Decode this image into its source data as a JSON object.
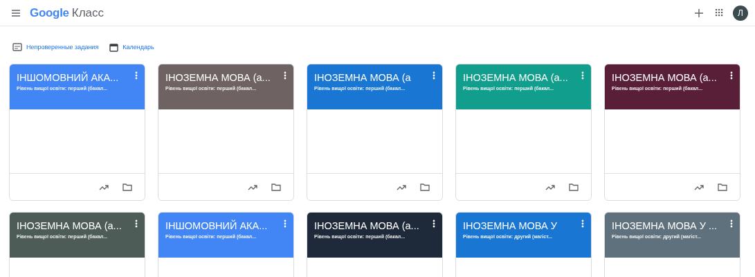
{
  "app_bar": {
    "logo_google": "Google",
    "logo_product": "Класс",
    "avatar_letter": "Л"
  },
  "links": [
    {
      "kind": "review",
      "label": "Непроверенные задания"
    },
    {
      "kind": "calendar",
      "label": "Календарь"
    }
  ],
  "cards": [
    {
      "title": "ІНШОМОВНИЙ АКА...",
      "subtitle": "Рівень вищої освіти: перший (бакал...",
      "color": "#4285f4"
    },
    {
      "title": "ІНОЗЕМНА МОВА (а...",
      "subtitle": "Рівень вищої освіти: перший (бакал...",
      "color": "#6e6262"
    },
    {
      "title": "ІНОЗЕМНА МОВА (а",
      "subtitle": "Рівень вищої освіти: перший (бакал...",
      "color": "#1976d2"
    },
    {
      "title": "ІНОЗЕМНА МОВА (а...",
      "subtitle": "Рівень вищої освіти: перший (бакал...",
      "color": "#129e8c"
    },
    {
      "title": "ІНОЗЕМНА МОВА (а...",
      "subtitle": "Рівень вищої освіти: перший (бакал...",
      "color": "#5a1f38"
    },
    {
      "title": "ІНОЗЕМНА МОВА (а...",
      "subtitle": "Рівень вищої освіти: перший (бакал...",
      "color": "#4d5c57"
    },
    {
      "title": "ІНШОМОВНИЙ АКА...",
      "subtitle": "Рівень вищої освіти: перший (бакал...",
      "color": "#4285f4"
    },
    {
      "title": "ІНОЗЕМНА МОВА (а...",
      "subtitle": "Рівень вищої освіти: перший (бакал...",
      "color": "#1e2a3a"
    },
    {
      "title": "ІНОЗЕМНА МОВА У",
      "subtitle": "Рівень вищої освіти: другий (магіст...",
      "color": "#1976d2"
    },
    {
      "title": "ІНОЗЕМНА МОВА У ...",
      "subtitle": "Рівень вищої освіти: другий (магіст...",
      "color": "#5f717c"
    }
  ]
}
